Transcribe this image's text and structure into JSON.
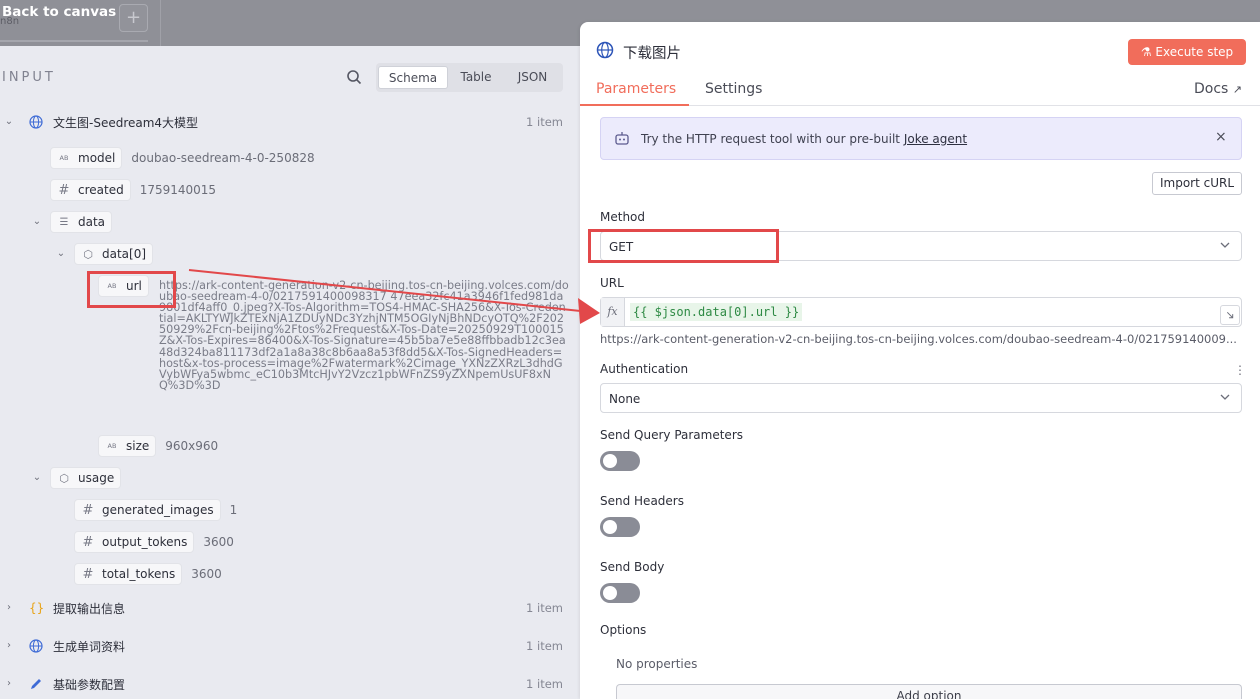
{
  "canvas": {
    "back_label": "Back to canvas",
    "ghost_node": "n8n",
    "plus": "+"
  },
  "input_panel": {
    "title": "INPUT",
    "view_tabs": [
      "Schema",
      "Table",
      "JSON"
    ],
    "nodes": [
      {
        "name": "文生图-Seedream4大模型",
        "count": "1 item",
        "icon": "globe-icon"
      },
      {
        "name": "提取输出信息",
        "count": "1 item",
        "icon": "braces-icon"
      },
      {
        "name": "生成单词资料",
        "count": "1 item",
        "icon": "globe-icon"
      },
      {
        "name": "基础参数配置",
        "count": "1 item",
        "icon": "pencil-icon"
      }
    ],
    "fields": {
      "model": {
        "key": "model",
        "value": "doubao-seedream-4-0-250828",
        "type": "AB"
      },
      "created": {
        "key": "created",
        "value": "1759140015",
        "type": "#"
      },
      "data": {
        "key": "data"
      },
      "data0": {
        "key": "data[0]"
      },
      "url": {
        "key": "url",
        "type": "AB",
        "value": "https://ark-content-generation-v2-cn-beijing.tos-cn-beijing.volces.com/doubao-seedream-4-0/0217591400098317 47eea32fc41a3946f1fed981da9801df4aff0_0.jpeg?X-Tos-Algorithm=TOS4-HMAC-SHA256&X-Tos-Credential=AKLTYWJkZTExNjA1ZDUyNDc3YzhjNTM5OGIyNjBhNDcyOTQ%2F20250929%2Fcn-beijing%2Ftos%2Frequest&X-Tos-Date=20250929T100015Z&X-Tos-Expires=86400&X-Tos-Signature=45b5ba7e5e88ffbbadb12c3ea48d324ba811173df2a1a8a38c8b6aa8a53f8dd5&X-Tos-SignedHeaders=host&x-tos-process=image%2Fwatermark%2Cimage_YXNzZXRzL3dhdGVybWFya5wbmc_eC10b3MtcHJvY2Vzcz1pbWFnZS9yZXNpemUsUF8xNQ%3D%3D"
      },
      "size": {
        "key": "size",
        "value": "960x960",
        "type": "AB"
      },
      "usage": {
        "key": "usage"
      },
      "generated_images": {
        "key": "generated_images",
        "value": "1",
        "type": "#"
      },
      "output_tokens": {
        "key": "output_tokens",
        "value": "3600",
        "type": "#"
      },
      "total_tokens": {
        "key": "total_tokens",
        "value": "3600",
        "type": "#"
      }
    }
  },
  "node_panel": {
    "title": "下载图片",
    "execute_label": "Execute step",
    "tabs": {
      "parameters": "Parameters",
      "settings": "Settings",
      "docs": "Docs"
    },
    "banner": {
      "text": "Try the HTTP request tool with our pre-built",
      "link": "Joke agent",
      "close": "×"
    },
    "import_curl": "Import cURL",
    "method": {
      "label": "Method",
      "value": "GET"
    },
    "url": {
      "label": "URL",
      "fx": "fx",
      "expression": "{{ $json.data[0].url }}",
      "preview": "https://ark-content-generation-v2-cn-beijing.tos-cn-beijing.volces.com/doubao-seedream-4-0/021759140009..."
    },
    "authentication": {
      "label": "Authentication",
      "value": "None"
    },
    "toggles": [
      {
        "label": "Send Query Parameters",
        "on": false
      },
      {
        "label": "Send Headers",
        "on": false
      },
      {
        "label": "Send Body",
        "on": false
      }
    ],
    "options": {
      "label": "Options",
      "empty": "No properties",
      "add": "Add option"
    }
  },
  "colors": {
    "accent": "#f16d5b",
    "annotation": "#e2484a",
    "expression_bg": "#e8f5e9"
  }
}
